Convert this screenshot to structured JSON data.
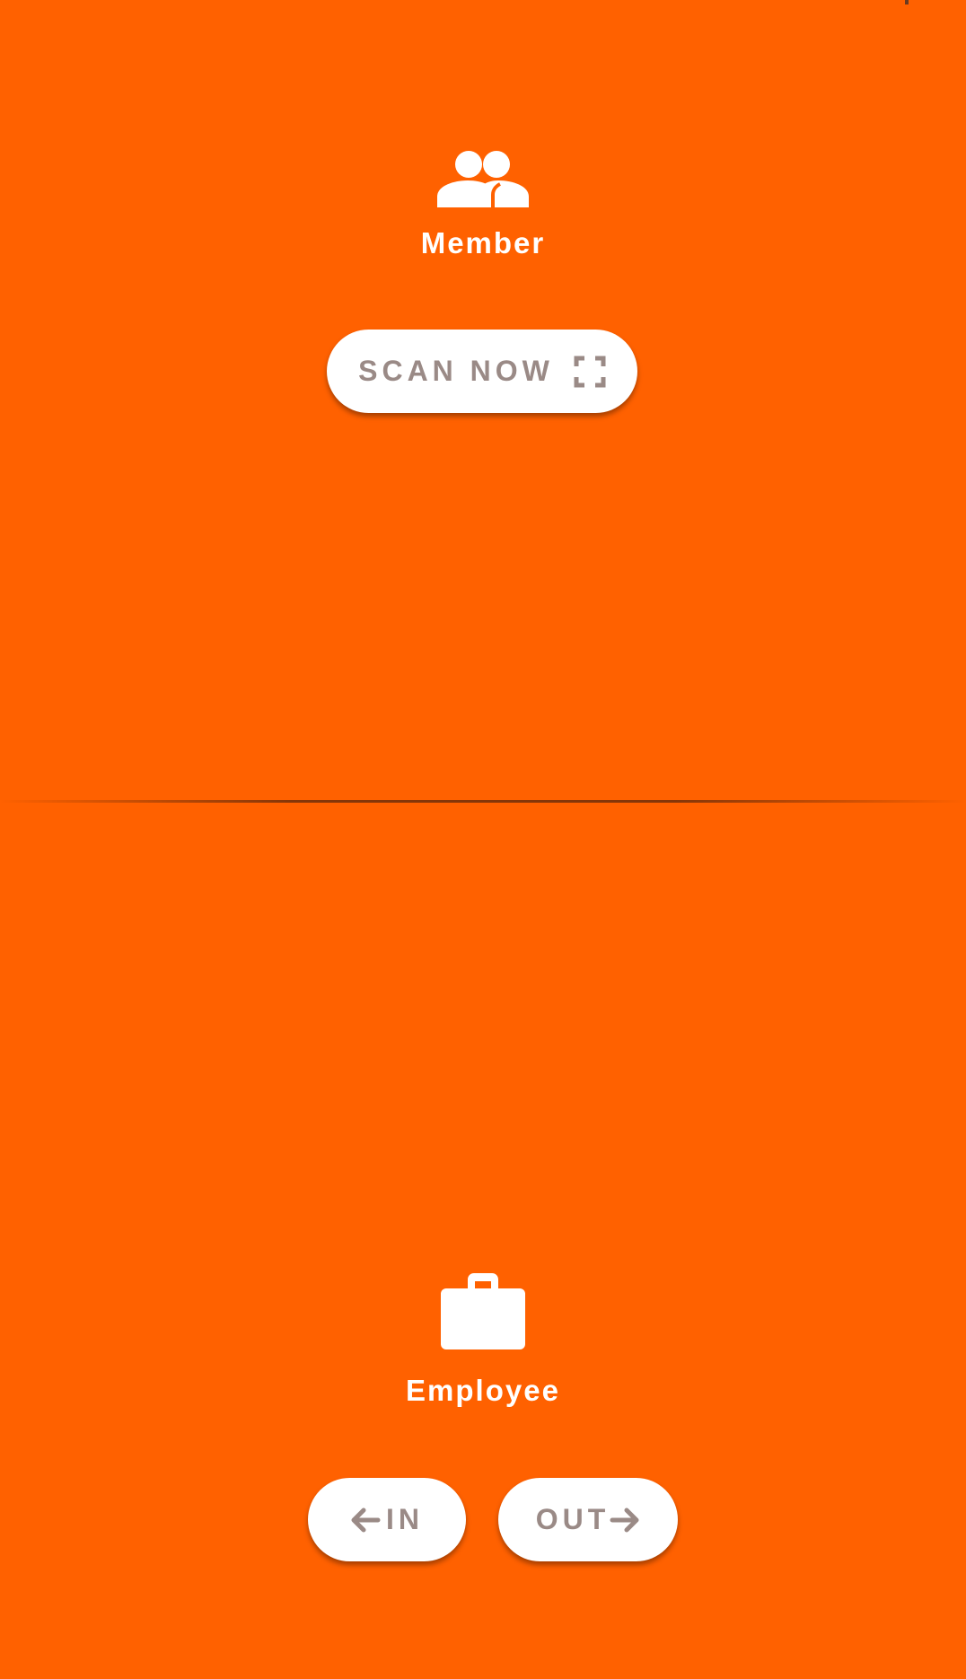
{
  "member": {
    "icon": "people-icon",
    "label": "Member",
    "scan_button": {
      "label": "SCAN NOW",
      "icon": "fullscreen-scan-icon"
    }
  },
  "employee": {
    "icon": "briefcase-icon",
    "label": "Employee",
    "in_button": {
      "label": "IN",
      "icon": "arrow-left-icon"
    },
    "out_button": {
      "label": "OUT",
      "icon": "arrow-right-icon"
    }
  },
  "colors": {
    "background": "#ff6100",
    "button_background": "#ffffff",
    "button_text": "#9a8a86",
    "label_text": "#ffffff"
  }
}
